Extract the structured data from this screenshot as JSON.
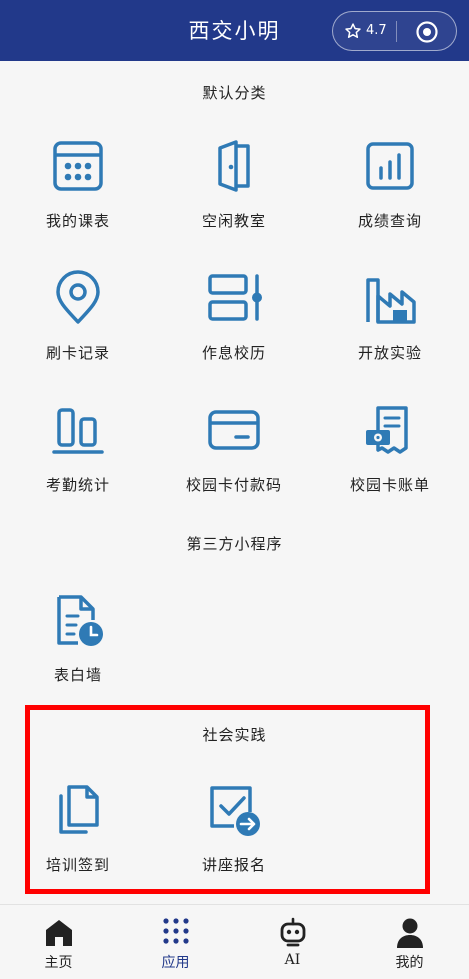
{
  "header": {
    "title": "西交小明",
    "rating": "4.7"
  },
  "sections": {
    "default": {
      "title": "默认分类",
      "items": [
        {
          "label": "我的课表",
          "icon": "calendar-icon"
        },
        {
          "label": "空闲教室",
          "icon": "door-icon"
        },
        {
          "label": "成绩查询",
          "icon": "bar-chart-icon"
        },
        {
          "label": "刷卡记录",
          "icon": "location-pin-icon"
        },
        {
          "label": "作息校历",
          "icon": "schedule-slider-icon"
        },
        {
          "label": "开放实验",
          "icon": "factory-icon"
        },
        {
          "label": "考勤统计",
          "icon": "attendance-bars-icon"
        },
        {
          "label": "校园卡付款码",
          "icon": "card-icon"
        },
        {
          "label": "校园卡账单",
          "icon": "bill-icon"
        }
      ]
    },
    "third_party": {
      "title": "第三方小程序",
      "items": [
        {
          "label": "表白墙",
          "icon": "document-clock-icon"
        }
      ]
    },
    "social": {
      "title": "社会实践",
      "items": [
        {
          "label": "培训签到",
          "icon": "copy-documents-icon"
        },
        {
          "label": "讲座报名",
          "icon": "checkbox-arrow-icon"
        }
      ]
    }
  },
  "tabbar": {
    "items": [
      {
        "label": "主页",
        "icon": "home-icon"
      },
      {
        "label": "应用",
        "icon": "apps-grid-icon"
      },
      {
        "label": "AI",
        "icon": "robot-icon"
      },
      {
        "label": "我的",
        "icon": "user-icon"
      }
    ],
    "active_index": 1
  },
  "colors": {
    "header": "#22398a",
    "icon": "#2f7ab5",
    "highlight": "#ff0000",
    "background": "#f6f6f6"
  }
}
